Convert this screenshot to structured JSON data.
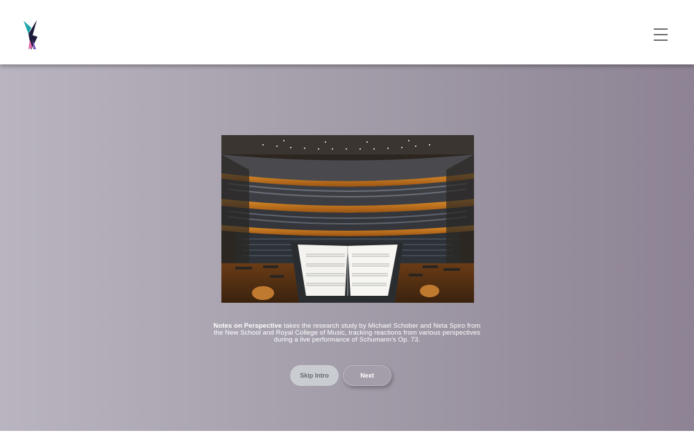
{
  "header": {
    "logo_icon": "brand-bolt-logo",
    "menu_icon": "hamburger-menu-icon"
  },
  "hero": {
    "image_subject": "concert-hall-with-music-score-on-stand"
  },
  "intro": {
    "title": "Notes on Perspective",
    "body": " takes the research study by Michael Schober and Neta Spiro from the New School and Royal College of Music, tracking reactions from various perspectives during a live performance of Schumann’s Op. 73."
  },
  "buttons": {
    "skip_label": "Skip Intro",
    "next_label": "Next"
  },
  "colors": {
    "background_left": "#b9b4bf",
    "background_right": "#8d8394",
    "header_bg": "#ffffff",
    "logo_teal": "#1aa6a8",
    "logo_navy": "#1d1b3a",
    "logo_pink": "#e06aa6",
    "logo_purple": "#7b5bb5"
  }
}
